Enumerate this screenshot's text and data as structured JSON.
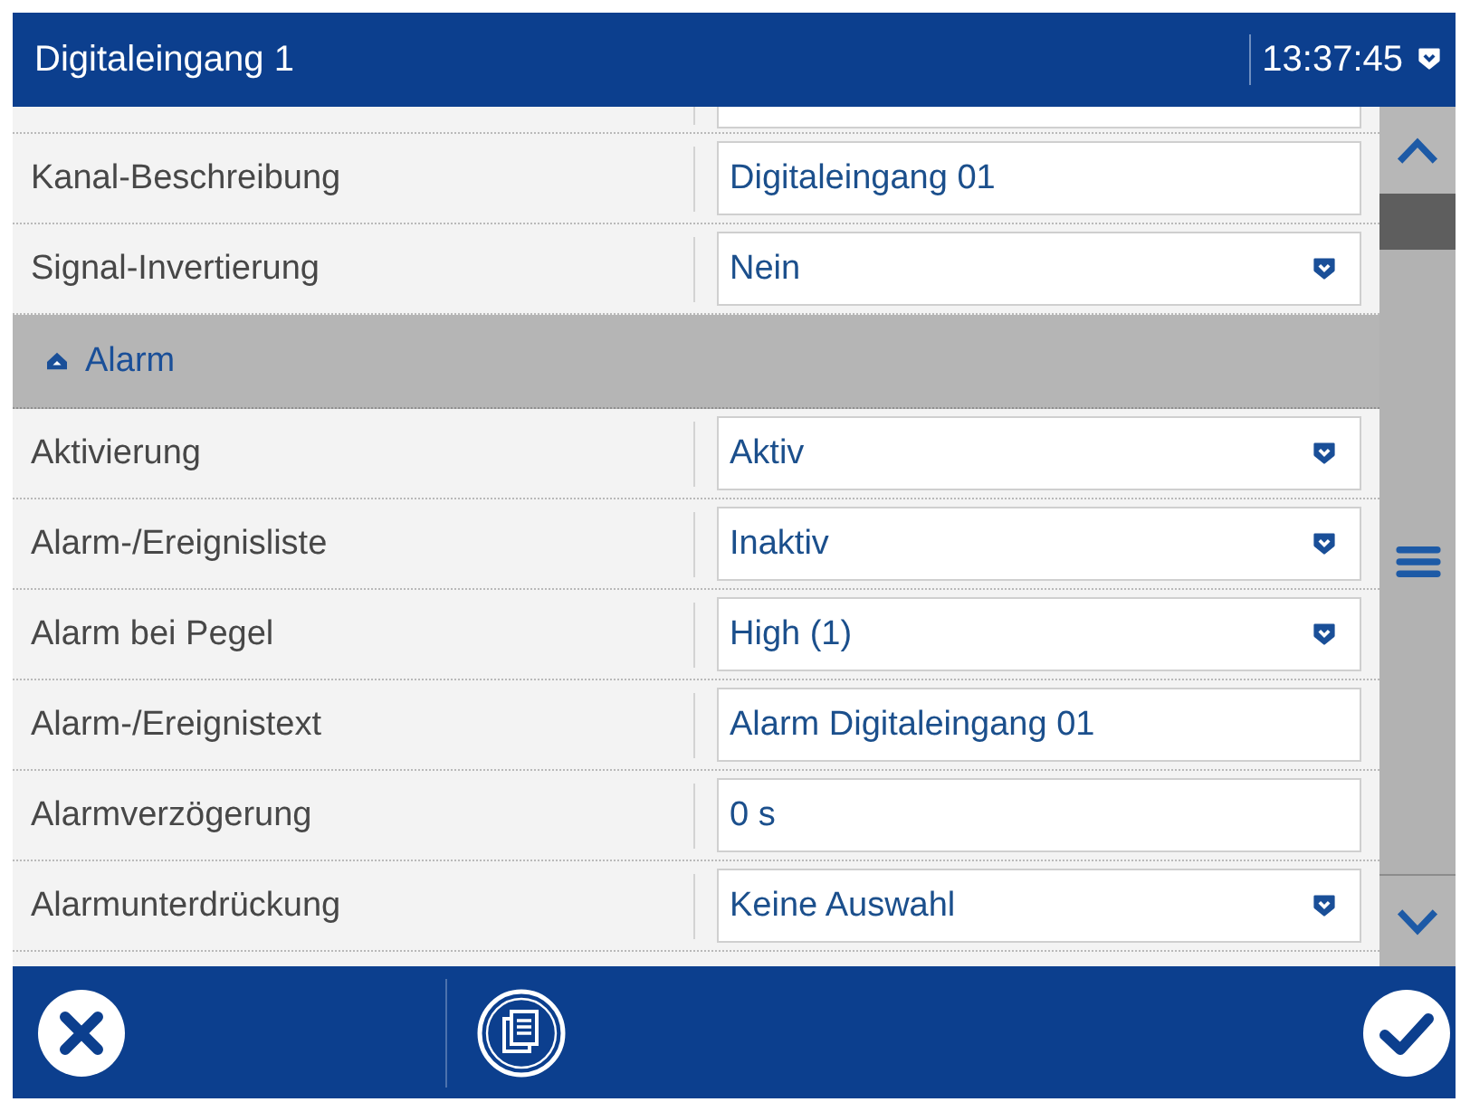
{
  "title_bar": {
    "title": "Digitaleingang 1",
    "time": "13:37:45"
  },
  "settings": [
    {
      "kind": "text",
      "label": "Kanal-Beschreibung",
      "value": "Digitaleingang 01"
    },
    {
      "kind": "select",
      "label": "Signal-Invertierung",
      "value": "Nein"
    },
    {
      "kind": "section",
      "label": "Alarm",
      "expanded": true
    },
    {
      "kind": "select",
      "label": "Aktivierung",
      "value": "Aktiv"
    },
    {
      "kind": "select",
      "label": "Alarm-/Ereignisliste",
      "value": "Inaktiv"
    },
    {
      "kind": "select",
      "label": "Alarm bei Pegel",
      "value": "High (1)"
    },
    {
      "kind": "text",
      "label": "Alarm-/Ereignistext",
      "value": "Alarm Digitaleingang 01"
    },
    {
      "kind": "text",
      "label": "Alarmverzögerung",
      "value": "0 s"
    },
    {
      "kind": "select",
      "label": "Alarmunterdrückung",
      "value": "Keine Auswahl"
    }
  ]
}
